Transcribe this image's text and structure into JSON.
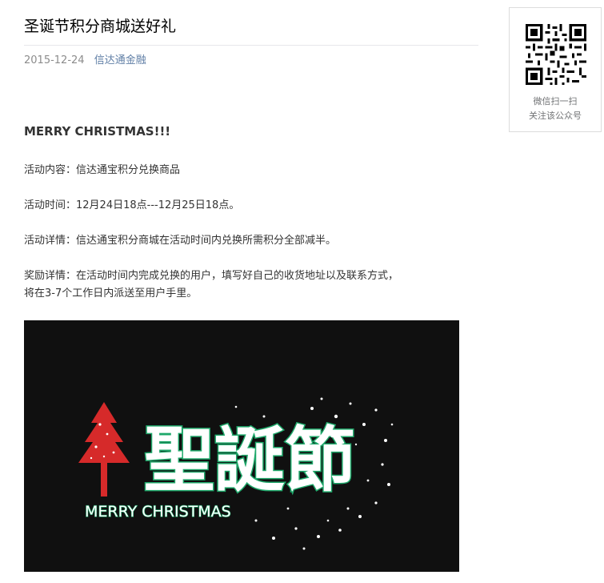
{
  "article": {
    "title": "圣诞节积分商城送好礼",
    "date": "2015-12-24",
    "account": "信达通金融",
    "headline": "MERRY CHRISTMAS!!!",
    "paragraphs": [
      "活动内容：信达通宝积分兑换商品",
      "活动时间：12月24日18点---12月25日18点。",
      "活动详情：信达通宝积分商城在活动时间内兑换所需积分全部减半。",
      "奖励详情：在活动时间内完成兑换的用户，填写好自己的收货地址以及联系方式，将在3-7个工作日内派送至用户手里。"
    ],
    "banner": {
      "big_text": "聖誕節",
      "sub_text": "MERRY CHRISTMAS"
    }
  },
  "sidebar": {
    "qr_caption_line1": "微信扫一扫",
    "qr_caption_line2": "关注该公众号"
  },
  "colors": {
    "link": "#607fa6",
    "meta": "#8c8c8c",
    "banner_bg": "#101010",
    "banner_green": "#1ea86a",
    "tree_red": "#d62a2a"
  }
}
